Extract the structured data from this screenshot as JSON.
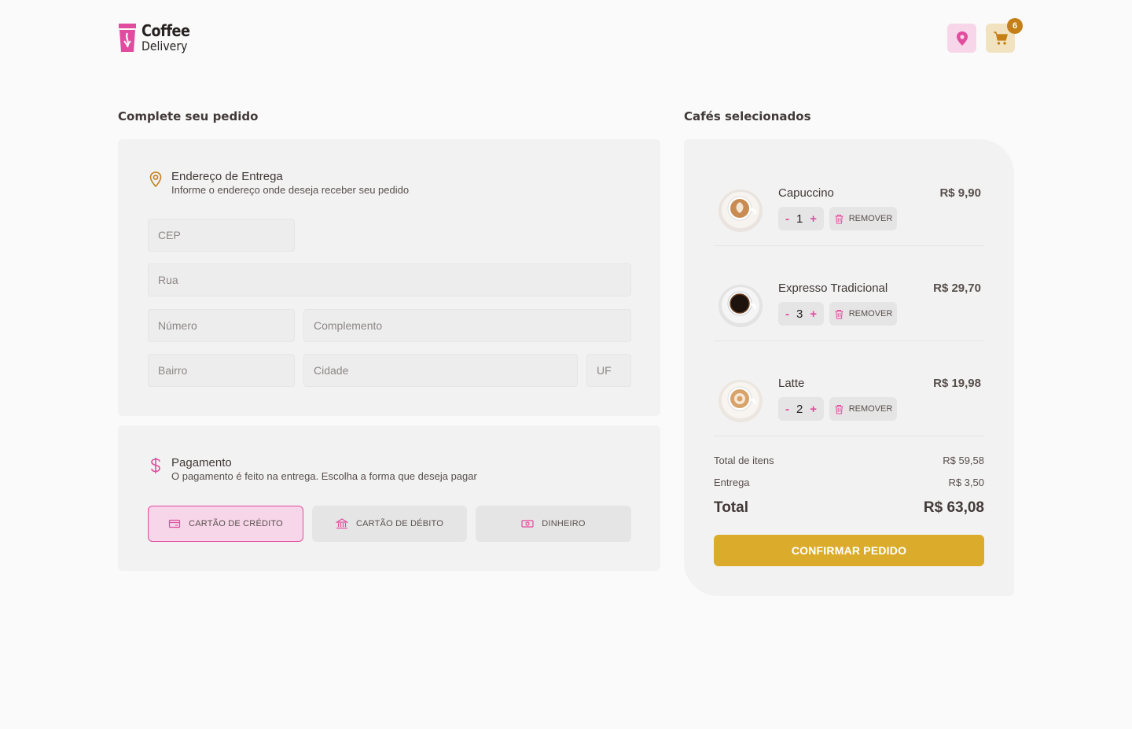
{
  "brand": {
    "name_line1": "Coffee",
    "name_line2": "Delivery",
    "accent": "#E24C9E",
    "yellow": "#DBAC2C"
  },
  "header": {
    "location_icon": "map-pin-icon",
    "cart_icon": "shopping-cart-icon",
    "cart_count": "6"
  },
  "checkout": {
    "title": "Complete seu pedido",
    "address": {
      "title": "Endereço de Entrega",
      "subtitle": "Informe o endereço onde deseja receber seu pedido",
      "fields": {
        "cep": "CEP",
        "rua": "Rua",
        "numero": "Número",
        "complemento": "Complemento",
        "bairro": "Bairro",
        "cidade": "Cidade",
        "uf": "UF"
      }
    },
    "payment": {
      "title": "Pagamento",
      "subtitle": "O pagamento é feito na entrega. Escolha a forma que deseja pagar",
      "options": [
        {
          "label": "CARTÃO DE CRÉDITO",
          "icon": "credit-card-icon",
          "selected": true
        },
        {
          "label": "CARTÃO DE DÉBITO",
          "icon": "bank-icon",
          "selected": false
        },
        {
          "label": "DINHEIRO",
          "icon": "money-icon",
          "selected": false
        }
      ]
    }
  },
  "cart": {
    "title": "Cafés selecionados",
    "items": [
      {
        "name": "Capuccino",
        "price": "R$ 9,90",
        "qty": "1",
        "minus": "-",
        "plus": "+",
        "remove": "REMOVER"
      },
      {
        "name": "Expresso Tradicional",
        "price": "R$ 29,70",
        "qty": "3",
        "minus": "-",
        "plus": "+",
        "remove": "REMOVER"
      },
      {
        "name": "Latte",
        "price": "R$ 19,98",
        "qty": "2",
        "minus": "-",
        "plus": "+",
        "remove": "REMOVER"
      }
    ],
    "totals": {
      "items_label": "Total de itens",
      "items_value": "R$ 59,58",
      "delivery_label": "Entrega",
      "delivery_value": "R$ 3,50",
      "total_label": "Total",
      "total_value": "R$ 63,08"
    },
    "confirm_label": "CONFIRMAR PEDIDO"
  }
}
